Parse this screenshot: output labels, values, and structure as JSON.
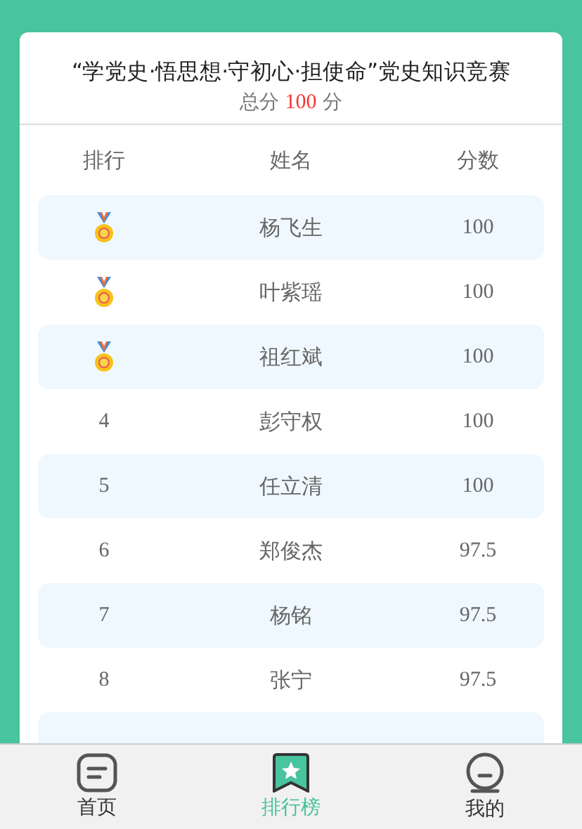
{
  "header": {
    "title": "“学党史·悟思想·守初心·担使命”党史知识竞赛",
    "total_label": "总分",
    "total_score": "100",
    "total_unit": "分"
  },
  "table": {
    "columns": [
      "排行",
      "姓名",
      "分数"
    ],
    "rows": [
      {
        "kind": "medal",
        "rank": "",
        "name": "杨飞生",
        "score": "100"
      },
      {
        "kind": "medal",
        "rank": "",
        "name": "叶紫瑶",
        "score": "100"
      },
      {
        "kind": "medal",
        "rank": "",
        "name": "祖红斌",
        "score": "100"
      },
      {
        "kind": "number",
        "rank": "4",
        "name": "彭守权",
        "score": "100"
      },
      {
        "kind": "number",
        "rank": "5",
        "name": "任立清",
        "score": "100"
      },
      {
        "kind": "number",
        "rank": "6",
        "name": "郑俊杰",
        "score": "97.5"
      },
      {
        "kind": "number",
        "rank": "7",
        "name": "杨铭",
        "score": "97.5"
      },
      {
        "kind": "number",
        "rank": "8",
        "name": "张宁",
        "score": "97.5"
      }
    ]
  },
  "tab_bar": [
    {
      "kind": "home",
      "label": "首页",
      "selected": false
    },
    {
      "kind": "ranking",
      "label": "排行榜",
      "selected": true
    },
    {
      "kind": "profile",
      "label": "我的",
      "selected": false
    }
  ]
}
